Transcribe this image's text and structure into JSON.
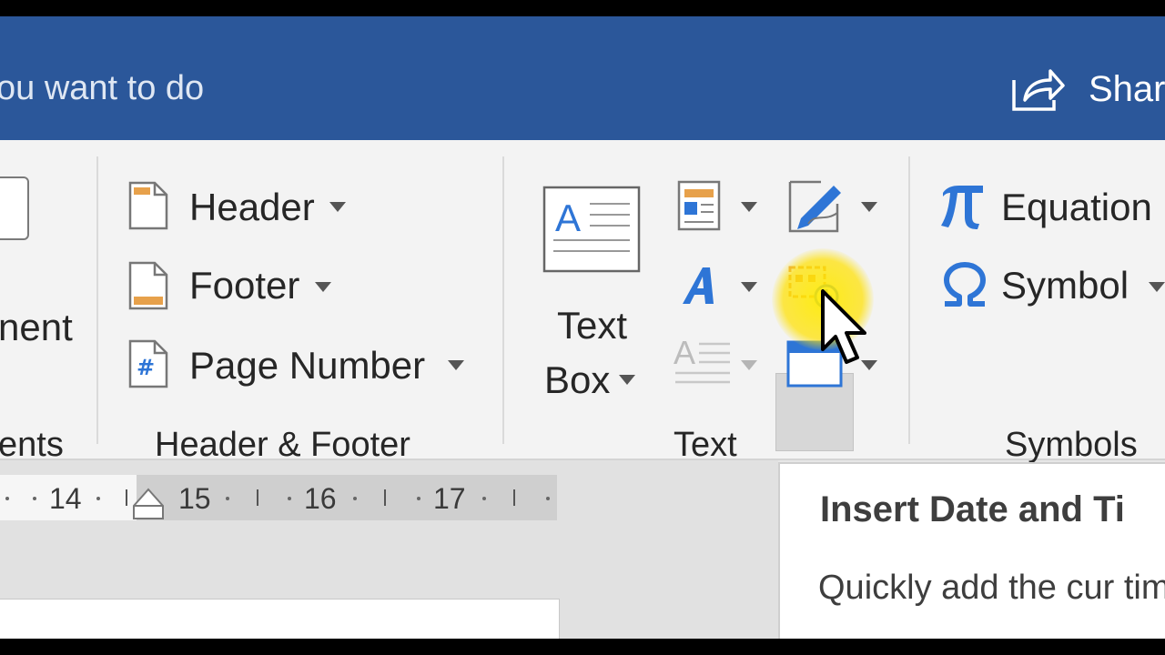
{
  "titlebar": {
    "tell_me_text": "ou want to do",
    "share_label": "Shar"
  },
  "ribbon": {
    "pages_group": {
      "partial_button_label": "nent",
      "group_label": "ents"
    },
    "header_footer_group": {
      "header_label": "Header",
      "footer_label": "Footer",
      "page_number_label": "Page Number",
      "group_label": "Header & Footer"
    },
    "text_group": {
      "text_box_line1": "Text",
      "text_box_line2": "Box",
      "group_label": "Text"
    },
    "symbols_group": {
      "equation_label": "Equation",
      "symbol_label": "Symbol",
      "group_label": "Symbols"
    }
  },
  "ruler": {
    "numbers": [
      "14",
      "15",
      "16",
      "17"
    ]
  },
  "tooltip": {
    "title": "Insert Date and Ti",
    "description": "Quickly add the cur time."
  },
  "colors": {
    "titlebar": "#2b579a",
    "ribbon": "#f3f3f3",
    "accent_blue": "#2e75d6",
    "accent_orange": "#e7a14b",
    "cursor_highlight": "#ffe600"
  },
  "icons": {
    "share": "share-icon",
    "header": "header-icon",
    "footer": "footer-icon",
    "page_number": "page-number-icon",
    "text_box": "text-box-icon",
    "quick_parts": "quick-parts-icon",
    "wordart": "wordart-icon",
    "drop_cap": "drop-cap-icon",
    "signature_line": "signature-line-icon",
    "date_time": "date-time-icon",
    "object": "object-icon",
    "equation": "pi-icon",
    "symbol": "omega-icon"
  }
}
